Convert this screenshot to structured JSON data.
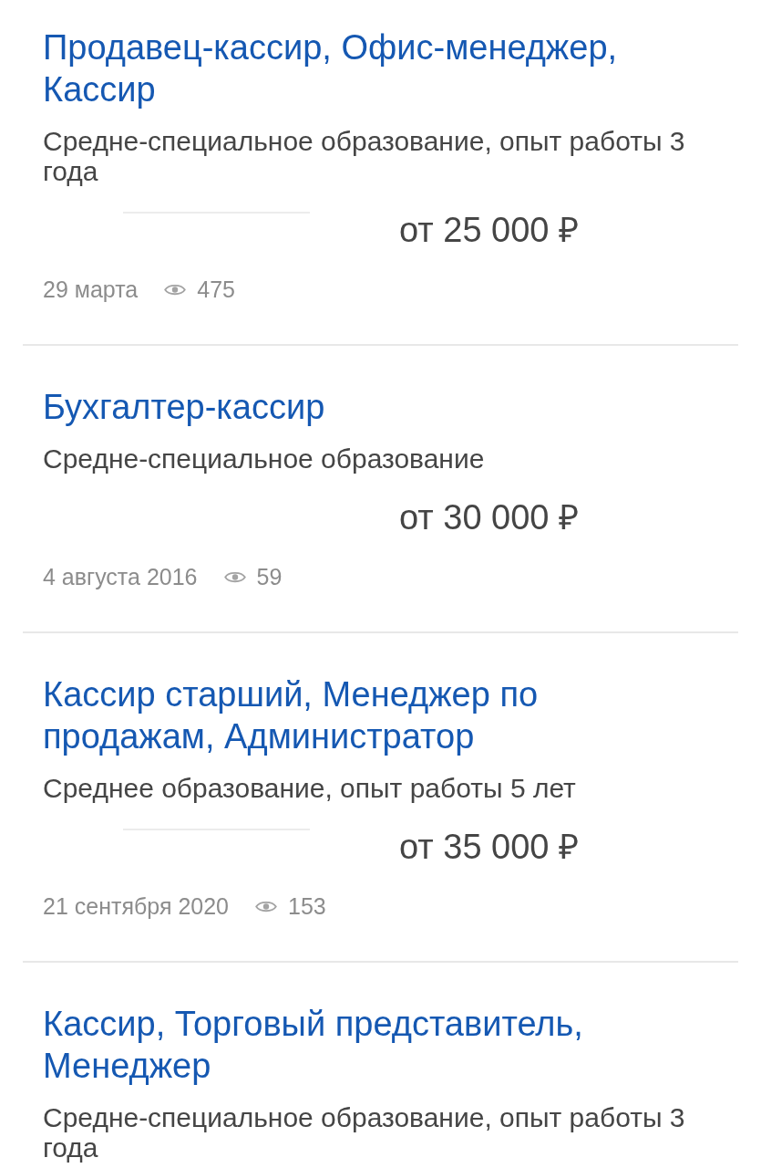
{
  "vacancies": [
    {
      "title": "Продавец-кассир, Офис-менеджер, Кассир",
      "requirements": "Средне-специальное образование, опыт работы 3 года",
      "short_line": true,
      "salary": "от 25 000 ₽",
      "date": "29 марта",
      "views": "475"
    },
    {
      "title": "Бухгалтер-кассир",
      "requirements": "Средне-специальное образование",
      "short_line": false,
      "salary": "от 30 000 ₽",
      "date": "4 августа 2016",
      "views": "59"
    },
    {
      "title": "Кассир старший, Менеджер по продажам, Администратор",
      "requirements": "Среднее образование, опыт работы 5 лет",
      "short_line": true,
      "salary": "от 35 000 ₽",
      "date": "21 сентября 2020",
      "views": "153"
    },
    {
      "title": "Кассир, Торговый представитель, Менеджер",
      "requirements": "Средне-специальное образование, опыт работы 3 года"
    }
  ]
}
